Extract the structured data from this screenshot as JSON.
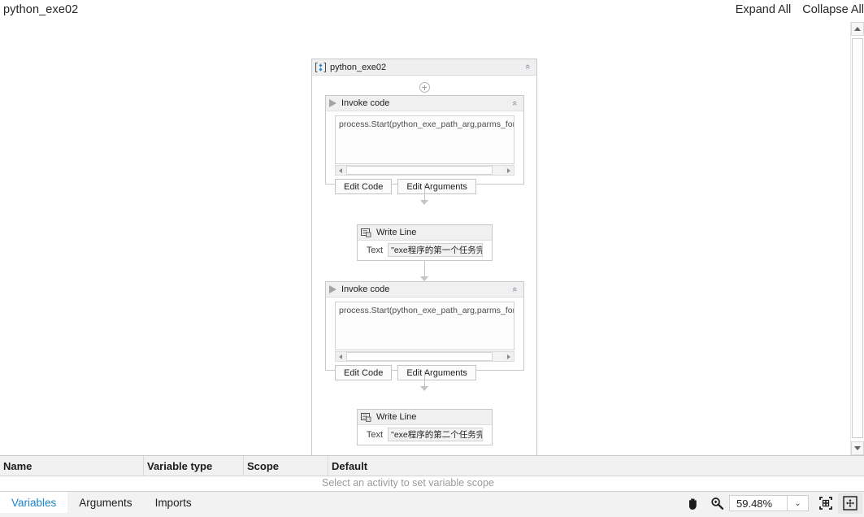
{
  "topbar": {
    "title": "python_exe02",
    "actions": [
      {
        "label": "Expand All",
        "name": "expand-all-button"
      },
      {
        "label": "Collapse All",
        "name": "collapse-all-button"
      }
    ]
  },
  "sequence": {
    "title": "python_exe02",
    "icon": "sequence-icon",
    "collapse_glyph": "«"
  },
  "activities": [
    {
      "type": "invoke-code",
      "title": "Invoke code",
      "icon": "play-icon",
      "code": "process.Start(python_exe_path_arg,parms_for_write",
      "buttons": [
        {
          "label": "Edit Code",
          "name": "edit-code-button"
        },
        {
          "label": "Edit Arguments",
          "name": "edit-arguments-button"
        }
      ]
    },
    {
      "type": "write-line",
      "title": "Write Line",
      "icon": "write-line-icon",
      "field_label": "Text",
      "field_value": "\"exe程序的第一个任务完成\""
    },
    {
      "type": "invoke-code",
      "title": "Invoke code",
      "icon": "play-icon",
      "code": "process.Start(python_exe_path_arg,parms_for_hand",
      "buttons": [
        {
          "label": "Edit Code",
          "name": "edit-code-button"
        },
        {
          "label": "Edit Arguments",
          "name": "edit-arguments-button"
        }
      ]
    },
    {
      "type": "write-line",
      "title": "Write Line",
      "icon": "write-line-icon",
      "field_label": "Text",
      "field_value": "\"exe程序的第二个任务完成\""
    }
  ],
  "variables_panel": {
    "columns": [
      {
        "label": "Name",
        "name": "column-name"
      },
      {
        "label": "Variable type",
        "name": "column-variable-type"
      },
      {
        "label": "Scope",
        "name": "column-scope"
      },
      {
        "label": "Default",
        "name": "column-default"
      }
    ],
    "hint": "Select an activity to set variable scope"
  },
  "statusbar": {
    "tabs": [
      {
        "label": "Variables",
        "name": "tab-variables",
        "active": true
      },
      {
        "label": "Arguments",
        "name": "tab-arguments",
        "active": false
      },
      {
        "label": "Imports",
        "name": "tab-imports",
        "active": false
      }
    ],
    "zoom_value": "59.48%",
    "zoom_caret": "⌄",
    "tools": [
      {
        "name": "pan-hand-icon"
      },
      {
        "name": "zoom-magnifier-icon"
      },
      {
        "name": "fit-to-screen-icon"
      },
      {
        "name": "overview-icon"
      }
    ]
  },
  "colors": {
    "accent": "#1b84c7",
    "card_header": "#f0f0f0",
    "border": "#c8c8c8",
    "connector": "#c4c4c4"
  }
}
